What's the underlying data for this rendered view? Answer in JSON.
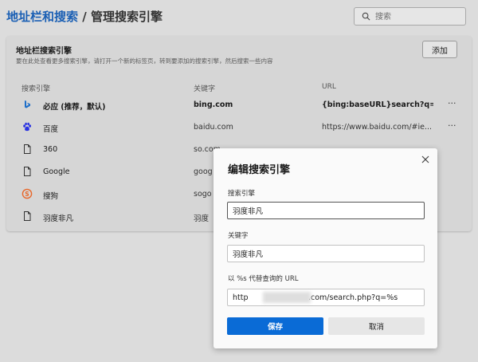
{
  "header": {
    "breadcrumb_link": "地址栏和搜索",
    "breadcrumb_sep": "/",
    "breadcrumb_current": "管理搜索引擎",
    "search_placeholder": "搜索"
  },
  "card": {
    "title": "地址栏搜索引擎",
    "description": "要在此处查看更多搜索引擎，请打开一个新的标签页，转到要添加的搜索引擎，然后搜索一些内容",
    "add_label": "添加",
    "columns": {
      "engine": "搜索引擎",
      "keyword": "关键字",
      "url": "URL"
    },
    "rows": [
      {
        "name": "必应 (推荐，默认)",
        "keyword": "bing.com",
        "url": "{bing:baseURL}search?q=...",
        "icon": "bing-icon",
        "bold": true
      },
      {
        "name": "百度",
        "keyword": "baidu.com",
        "url": "https://www.baidu.com/#ie...",
        "icon": "baidu-paw-icon",
        "bold": false
      },
      {
        "name": "360",
        "keyword": "so.com",
        "url": "",
        "icon": "document-icon",
        "bold": false
      },
      {
        "name": "Google",
        "keyword": "goog",
        "url": "",
        "icon": "document-icon",
        "bold": false
      },
      {
        "name": "搜狗",
        "keyword": "sogo",
        "url": "",
        "icon": "sogou-icon",
        "bold": false
      },
      {
        "name": "羽度非凡",
        "keyword": "羽度",
        "url": "",
        "icon": "document-icon",
        "bold": false
      }
    ],
    "more_label": "···"
  },
  "dialog": {
    "title": "编辑搜索引擎",
    "engine_label": "搜索引擎",
    "engine_value": "羽度非凡",
    "keyword_label": "关键字",
    "keyword_value": "羽度非凡",
    "url_label": "以 %s 代替查询的 URL",
    "url_value": "http                         .com/search.php?q=%s",
    "save_label": "保存",
    "cancel_label": "取消"
  },
  "colors": {
    "accent": "#0a6bd6",
    "link": "#1a5fb4",
    "sogou": "#e8672a",
    "bing": "#1d6fc9",
    "baidu": "#2932e1"
  }
}
